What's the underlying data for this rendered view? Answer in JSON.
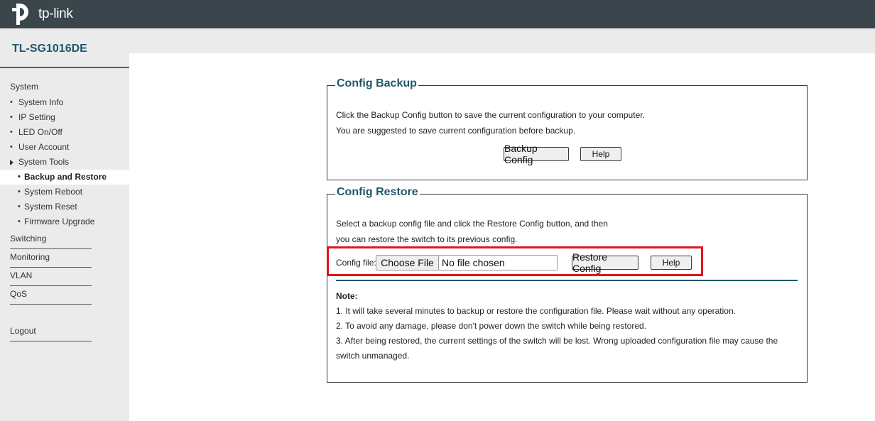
{
  "brand": {
    "logo_text": "tp-link",
    "model": "TL-SG1016DE"
  },
  "sidebar": {
    "system_heading": "System",
    "items": [
      {
        "label": "System Info",
        "bullet": "•"
      },
      {
        "label": "IP Setting",
        "bullet": "•"
      },
      {
        "label": "LED On/Off",
        "bullet": "•"
      },
      {
        "label": "User Account",
        "bullet": "•"
      },
      {
        "label": "System Tools"
      }
    ],
    "subitems": [
      {
        "label": "Backup and Restore",
        "bullet": "•",
        "active": true
      },
      {
        "label": "System Reboot",
        "bullet": "•"
      },
      {
        "label": "System Reset",
        "bullet": "•"
      },
      {
        "label": "Firmware Upgrade",
        "bullet": "•"
      }
    ],
    "sections": [
      "Switching",
      "Monitoring",
      "VLAN",
      "QoS"
    ],
    "logout": "Logout"
  },
  "backup": {
    "title": "Config Backup",
    "line1": "Click the Backup Config button to save the current configuration to your computer.",
    "line2": "You are suggested to save current configuration before backup.",
    "backup_btn": "Backup Config",
    "help_btn": "Help"
  },
  "restore": {
    "title": "Config Restore",
    "line1": "Select a backup config file and click the Restore Config button, and then",
    "line2": "you can restore the switch to its previous config.",
    "config_label": "Config file:",
    "choose_btn": "Choose File",
    "file_status": "No file chosen",
    "restore_btn": "Restore Config",
    "help_btn": "Help",
    "note_title": "Note:",
    "notes": [
      "1. It will take several minutes to backup or restore the configuration file. Please wait without any operation.",
      "2. To avoid any damage, please don't power down the switch while being restored.",
      "3. After being restored, the current settings of the switch will be lost. Wrong uploaded configuration file may cause the",
      "switch unmanaged."
    ]
  },
  "colors": {
    "header": "#3a454c",
    "accent": "#1f5869",
    "highlight": "#e3141c",
    "sidebar_bg": "#ebebeb"
  }
}
